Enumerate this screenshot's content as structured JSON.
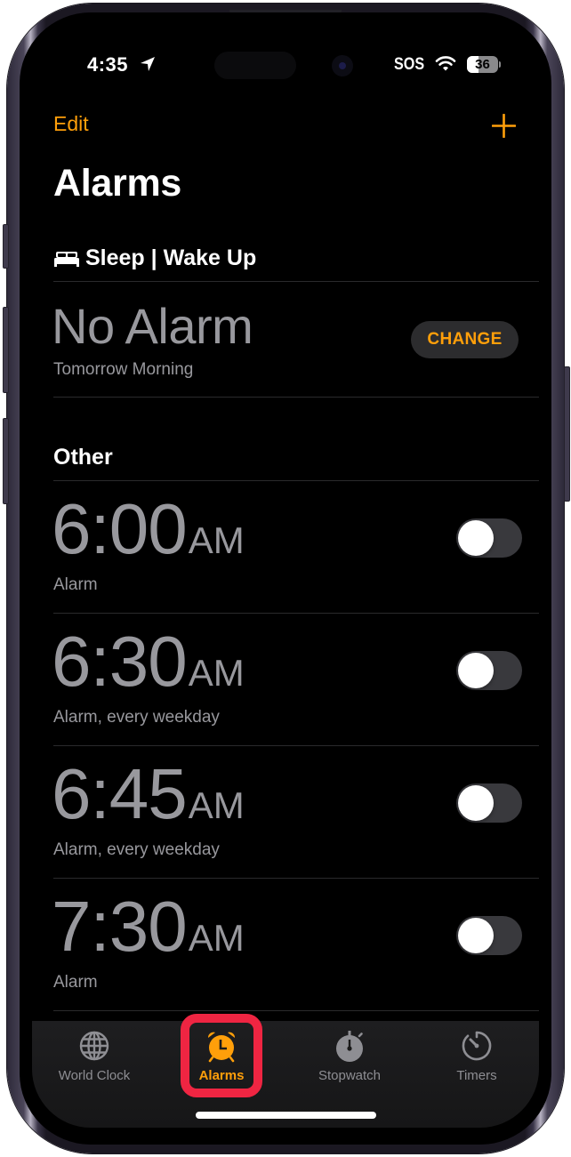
{
  "status_bar": {
    "time": "4:35",
    "location_icon": "location-arrow-icon",
    "carrier": "SOS",
    "wifi_icon": "wifi-icon",
    "battery_level": "36",
    "battery_fraction": 0.36
  },
  "nav": {
    "edit_label": "Edit",
    "add_icon": "plus-icon",
    "title": "Alarms"
  },
  "sleep": {
    "icon": "bed-icon",
    "header": "Sleep | Wake Up",
    "status": "No Alarm",
    "subtitle": "Tomorrow Morning",
    "change_label": "CHANGE"
  },
  "other_section": {
    "header": "Other"
  },
  "alarms": [
    {
      "time": "6:00",
      "ampm": "AM",
      "label": "Alarm",
      "enabled": false
    },
    {
      "time": "6:30",
      "ampm": "AM",
      "label": "Alarm, every weekday",
      "enabled": false
    },
    {
      "time": "6:45",
      "ampm": "AM",
      "label": "Alarm, every weekday",
      "enabled": false
    },
    {
      "time": "7:30",
      "ampm": "AM",
      "label": "Alarm",
      "enabled": false
    }
  ],
  "tabbar": {
    "active": "Alarms",
    "items": [
      {
        "label": "World Clock",
        "icon": "globe-icon"
      },
      {
        "label": "Alarms",
        "icon": "alarm-clock-icon"
      },
      {
        "label": "Stopwatch",
        "icon": "stopwatch-icon"
      },
      {
        "label": "Timers",
        "icon": "timer-icon"
      }
    ]
  },
  "colors": {
    "accent": "#ff9f0a",
    "highlight": "#ef2542",
    "secondary_text": "#98989d",
    "background": "#000000"
  }
}
